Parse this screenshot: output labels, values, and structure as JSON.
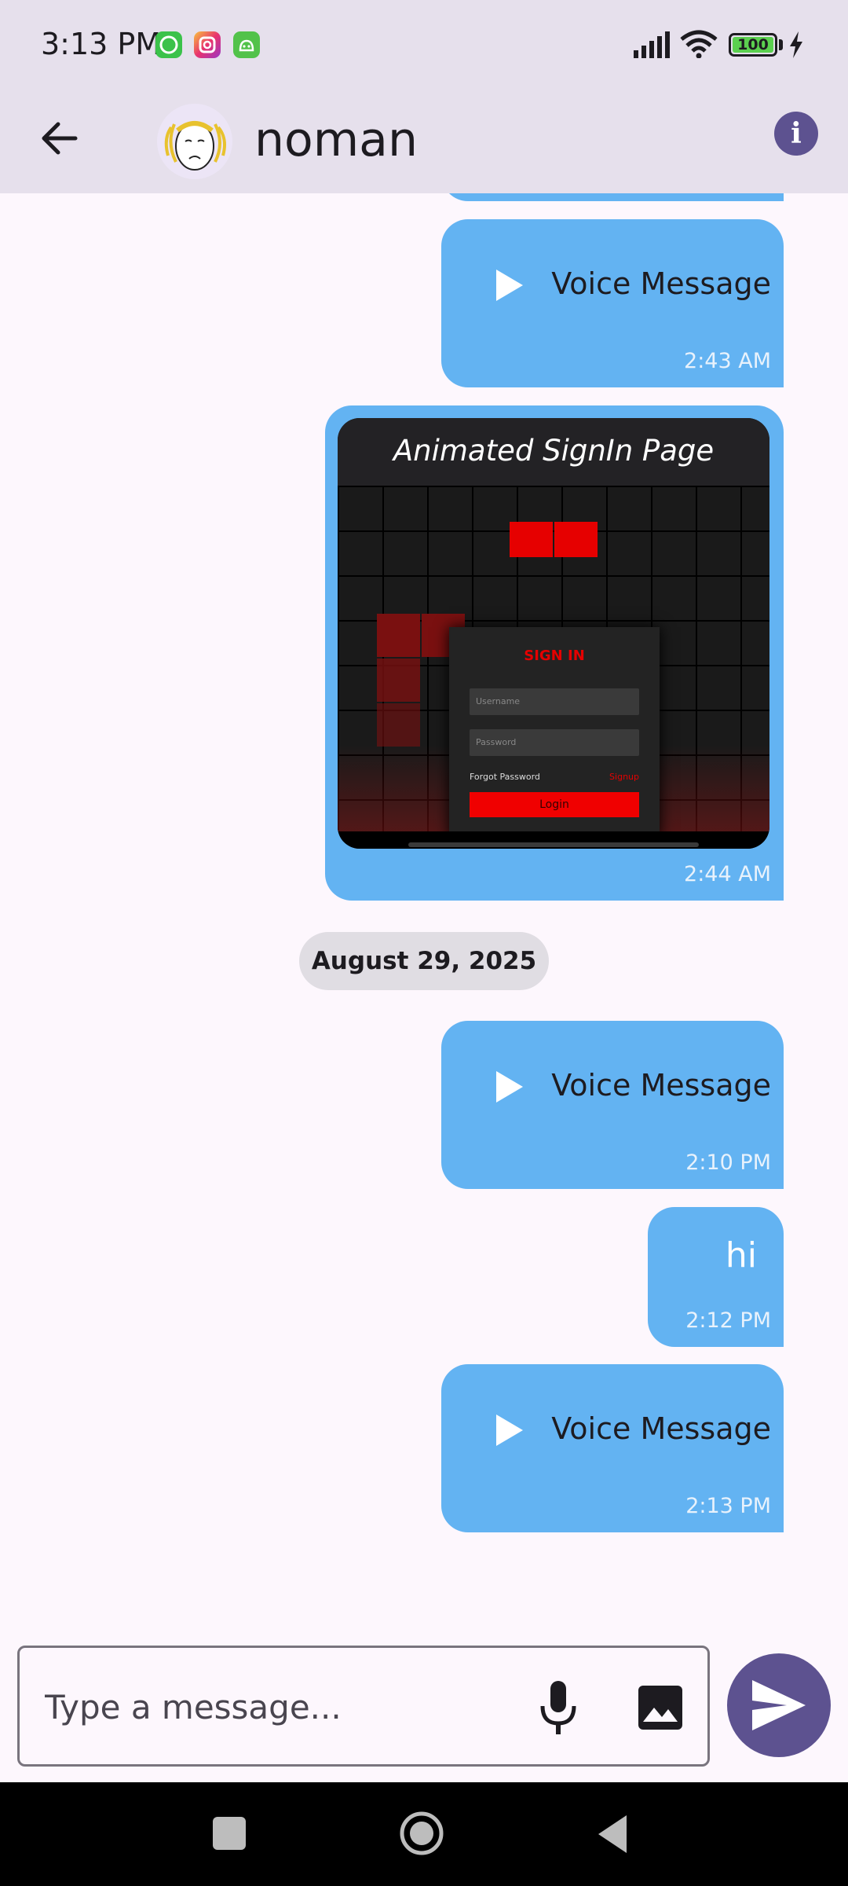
{
  "status_bar": {
    "time": "3:13 PM",
    "battery": "100",
    "notification_icons": [
      "whatsapp-icon",
      "instagram-icon",
      "android-app-icon"
    ]
  },
  "app_bar": {
    "title": "noman",
    "info_glyph": "i"
  },
  "messages": [
    {
      "type": "voice",
      "label": "Voice Message",
      "time": "2:43 AM"
    },
    {
      "type": "image",
      "image_title": "Animated SignIn Page",
      "time": "2:44 AM",
      "preview": {
        "card_title": "SIGN IN",
        "username_placeholder": "Username",
        "password_placeholder": "Password",
        "forgot": "Forgot Password",
        "signup": "Signup",
        "login": "Login"
      }
    },
    {
      "type": "date",
      "label": "August 29, 2025"
    },
    {
      "type": "voice",
      "label": "Voice Message",
      "time": "2:10 PM"
    },
    {
      "type": "text",
      "text": "hi",
      "time": "2:12 PM"
    },
    {
      "type": "voice",
      "label": "Voice Message",
      "time": "2:13 PM"
    }
  ],
  "composer": {
    "placeholder": "Type a message..."
  },
  "colors": {
    "bubble": "#63b3f2",
    "app_bar": "#e6e0ec",
    "accent": "#5d5290",
    "background": "#fdf7fd"
  }
}
